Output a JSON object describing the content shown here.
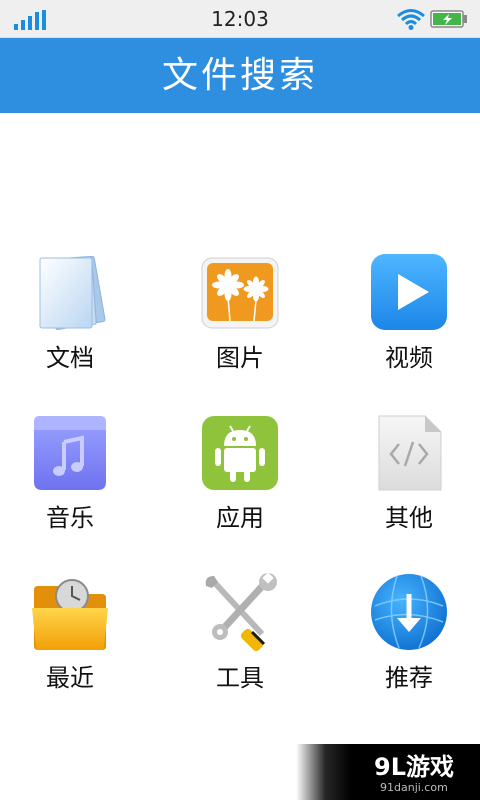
{
  "status_bar": {
    "time": "12:03",
    "signal_icon": "signal-bars-icon",
    "wifi_icon": "wifi-icon",
    "battery_icon": "battery-charging-icon"
  },
  "header": {
    "title": "文件搜索",
    "background": "#2e8fe0"
  },
  "categories": [
    {
      "label": "文档",
      "icon": "document-stack-icon"
    },
    {
      "label": "图片",
      "icon": "flower-picture-icon"
    },
    {
      "label": "视频",
      "icon": "play-video-icon"
    },
    {
      "label": "音乐",
      "icon": "music-folder-icon"
    },
    {
      "label": "应用",
      "icon": "android-app-icon"
    },
    {
      "label": "其他",
      "icon": "code-file-icon"
    },
    {
      "label": "最近",
      "icon": "clock-folder-icon"
    },
    {
      "label": "工具",
      "icon": "wrench-screwdriver-icon"
    },
    {
      "label": "推荐",
      "icon": "download-globe-icon"
    }
  ],
  "watermark": {
    "logo_text": "9L游戏",
    "site": "91danji.com"
  }
}
